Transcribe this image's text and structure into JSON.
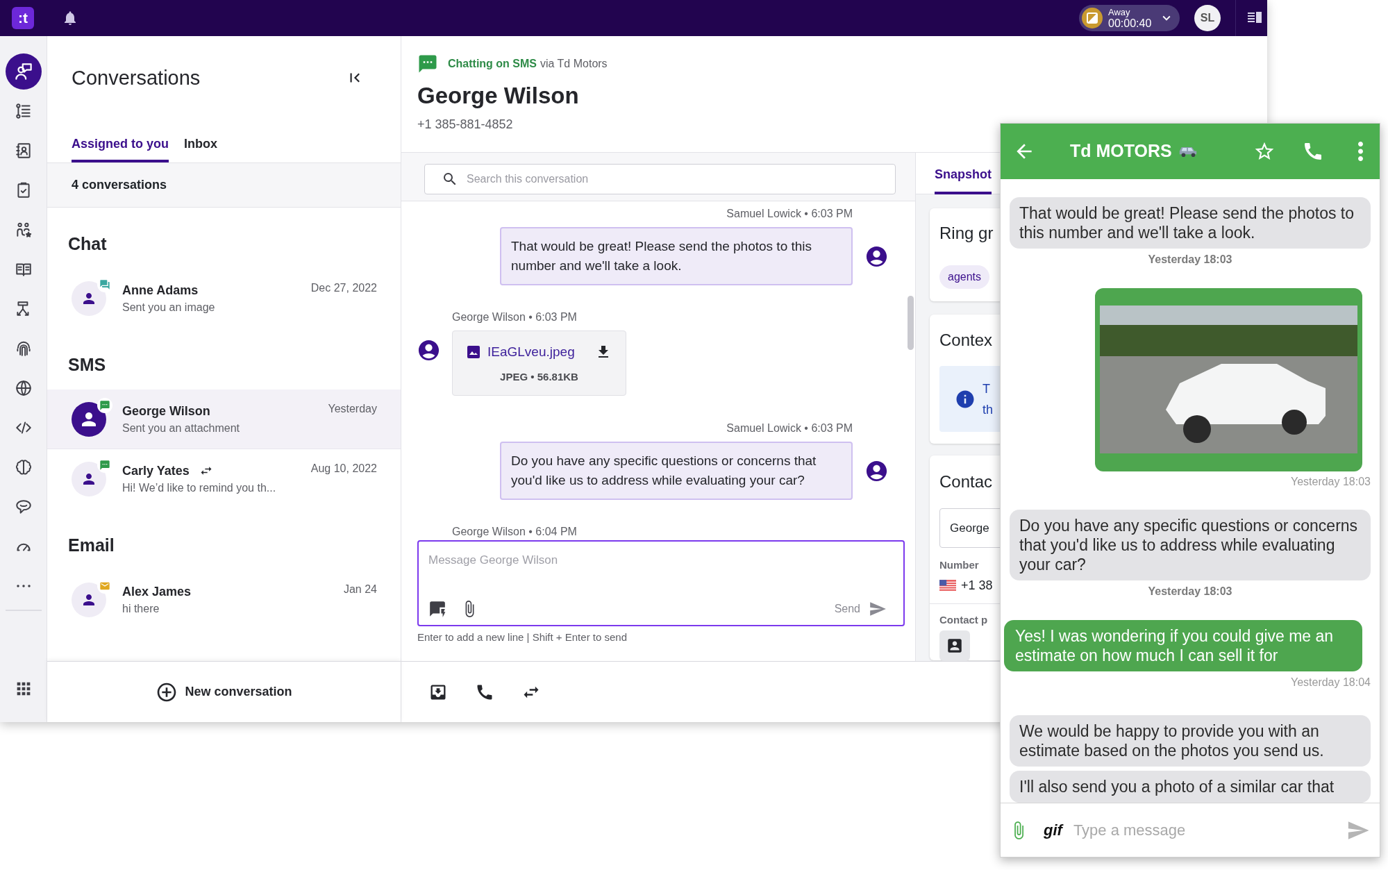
{
  "top_bar": {
    "logo": ":t",
    "status": {
      "label": "Away",
      "timer": "00:00:40"
    },
    "user_initials": "SL"
  },
  "rail": {
    "items": [
      {
        "selected": true
      },
      {
        "selected": false
      },
      {
        "selected": false
      },
      {
        "selected": false
      },
      {
        "selected": false
      },
      {
        "selected": false
      },
      {
        "selected": false
      },
      {
        "selected": false
      },
      {
        "selected": false
      },
      {
        "selected": false
      },
      {
        "selected": false
      },
      {
        "selected": false
      },
      {
        "selected": false
      },
      {
        "selected": false
      }
    ]
  },
  "conversations": {
    "title": "Conversations",
    "tabs": [
      {
        "label": "Assigned to you",
        "selected": true
      },
      {
        "label": "Inbox",
        "selected": false
      }
    ],
    "count": "4 conversations",
    "sections": [
      {
        "heading": "Chat",
        "rows": [
          {
            "kind": "chat",
            "name": "Anne Adams",
            "preview": "Sent you an image",
            "date": "Dec 27, 2022",
            "selected": false,
            "transferred": false
          }
        ]
      },
      {
        "heading": "SMS",
        "rows": [
          {
            "kind": "sms",
            "name": "George Wilson",
            "preview": "Sent you an attachment",
            "date": "Yesterday",
            "selected": true,
            "transferred": false
          },
          {
            "kind": "sms",
            "name": "Carly Yates",
            "preview": "Hi! We’d like to remind you th...",
            "date": "Aug 10, 2022",
            "selected": false,
            "transferred": true
          }
        ]
      },
      {
        "heading": "Email",
        "rows": [
          {
            "kind": "email",
            "name": "Alex James",
            "preview": "hi there",
            "date": "Jan 24",
            "selected": false,
            "transferred": false
          }
        ]
      }
    ],
    "new_button": "New conversation"
  },
  "chat": {
    "channel_label": "Chatting on SMS",
    "via": "via Td Motors",
    "contact_name": "George Wilson",
    "phone": "+1 385-881-4852",
    "search": {
      "placeholder": "Search this conversation"
    },
    "messages": [
      {
        "kind": "agent",
        "meta": "Samuel Lowick • 6:03 PM",
        "text": "That would be great! Please send the photos to this number and we'll take a look."
      },
      {
        "kind": "attachment",
        "meta": "George Wilson • 6:03 PM",
        "file_name": "IEaGLveu.jpeg",
        "file_info": "JPEG • 56.81KB"
      },
      {
        "kind": "agent",
        "meta": "Samuel Lowick • 6:03 PM",
        "text": "Do you have any specific questions or concerns that you'd like us to address while evaluating your car?"
      },
      {
        "kind": "contact_meta",
        "meta": "George Wilson • 6:04 PM"
      }
    ],
    "composer": {
      "placeholder": "Message George Wilson",
      "send": "Send",
      "hint": "Enter to add a new line | Shift + Enter to send"
    }
  },
  "snapshot_panel": {
    "tabs": [
      {
        "label": "Snapshot",
        "selected": true
      }
    ],
    "ring_group": {
      "title": "Ring gr",
      "tag": "agents"
    },
    "context": {
      "title": "Contex",
      "lines": [
        "T",
        "th"
      ]
    },
    "contact": {
      "title": "Contac",
      "name_field": "George",
      "number_label": "Number",
      "number": "+1 38",
      "contact_label": "Contact p"
    }
  },
  "phone": {
    "title": "Td MOTORS",
    "messages": [
      {
        "kind": "received",
        "text": "That would be great! Please send the photos to this number and we'll take a look.",
        "time": "Yesterday 18:03"
      },
      {
        "kind": "sent_image",
        "time": "Yesterday 18:03"
      },
      {
        "kind": "received",
        "text": "Do you have any specific questions or concerns that you'd like us to address while evaluating your car?",
        "time": "Yesterday 18:03"
      },
      {
        "kind": "sent",
        "text": "Yes! I was wondering if you could give me an estimate on how much I can sell it for",
        "time": "Yesterday 18:04"
      },
      {
        "kind": "received",
        "text": "We would be happy to provide you with an estimate based on the photos you send us."
      },
      {
        "kind": "received",
        "text": "I'll also send you a photo of a similar car that"
      }
    ],
    "composer": {
      "gif": "gif",
      "placeholder": "Type a message"
    }
  }
}
